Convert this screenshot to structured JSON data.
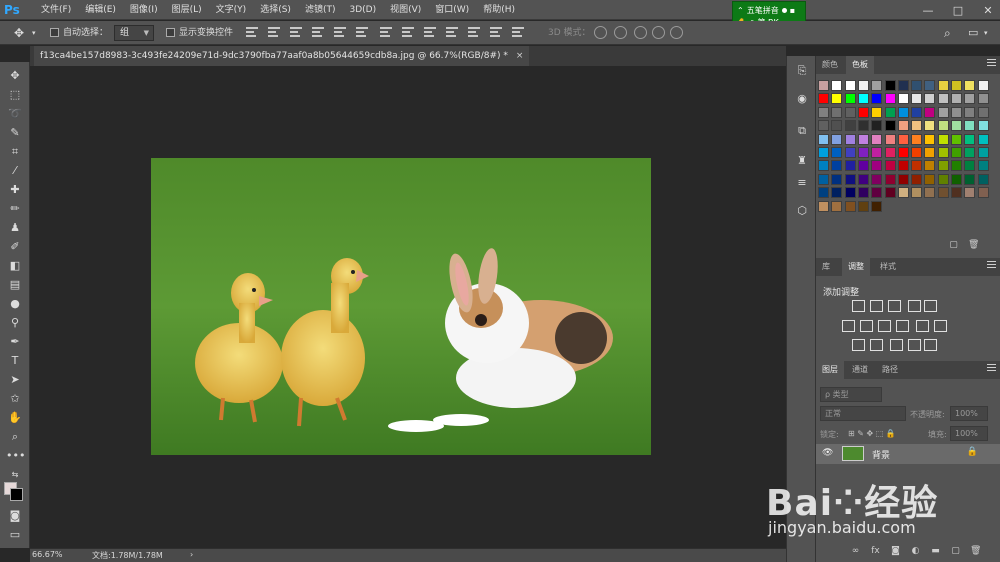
{
  "app": {
    "logo": "Ps"
  },
  "menu": [
    "文件(F)",
    "编辑(E)",
    "图像(I)",
    "图层(L)",
    "文字(Y)",
    "选择(S)",
    "滤镜(T)",
    "3D(D)",
    "视图(V)",
    "窗口(W)",
    "帮助(H)"
  ],
  "window_controls": [
    "—",
    "□",
    "✕"
  ],
  "ime": {
    "line1": "五笔拼音",
    "line2": "简 BK"
  },
  "options": {
    "auto_select_label": "自动选择：",
    "auto_select_value": "组",
    "show_transform_label": "显示变换控件",
    "mode_3d_label": "3D 模式："
  },
  "document": {
    "tab_title": "f13ca4be157d8983-3c493fe24209e71d-9dc3790fba77aaf0a8b05644659cdb8a.jpg @ 66.7%(RGB/8#) *",
    "tab_close": "×"
  },
  "status": {
    "zoom": "66.67%",
    "doc_info": "文档:1.78M/1.78M",
    "arrow": "›"
  },
  "swatches_panel": {
    "tabs": [
      "颜色",
      "色板"
    ],
    "active_tab": 1
  },
  "adjust_panel": {
    "tabs": [
      "库",
      "调整",
      "样式"
    ],
    "active_tab": 1,
    "title": "添加调整"
  },
  "layers_panel": {
    "tabs": [
      "图层",
      "通道",
      "路径"
    ],
    "active_tab": 0,
    "filter_label": "ρ 类型",
    "blend_mode": "正常",
    "opacity_label": "不透明度:",
    "opacity_value": "100%",
    "lock_label": "锁定:",
    "fill_label": "填充:",
    "fill_value": "100%",
    "layer_name": "背景",
    "footer": [
      "∞",
      "fx",
      "◙",
      "◐",
      "▬",
      "▢",
      "🗑"
    ]
  },
  "watermark": {
    "logo": "Bai⁘经验",
    "url": "jingyan.baidu.com"
  },
  "colors": {
    "menubar": "#535353",
    "canvas_bg": "#282828",
    "ime_green": "#0d7a16",
    "ps_blue": "#31a8ff"
  },
  "swatch_colors": [
    [
      "#c8a0a0",
      "#ffffff",
      "#ffffff",
      "#f0f0f0",
      "#a0a0a0",
      "#000000",
      "#203050",
      "#305070",
      "#406080",
      "#e8d040",
      "#d0c020",
      "#f0e060",
      "#f0f0f0"
    ],
    [
      "#ff0000",
      "#ffff00",
      "#00ff00",
      "#00ffff",
      "#0000ff",
      "#ff00ff",
      "#ffffff",
      "#e8e8e8",
      "#d0d0d0",
      "#c0c0c0",
      "#b0b0b0",
      "#a0a0a0",
      "#909090"
    ],
    [
      "#808080",
      "#707070",
      "#606060",
      "#ff0000",
      "#ffd000",
      "#00a050",
      "#0090e0",
      "#2040a0",
      "#c00080",
      "#a0a0a0",
      "#909090",
      "#808080",
      "#707070"
    ],
    [
      "#606060",
      "#505050",
      "#404040",
      "#303030",
      "#202020",
      "#000000",
      "#f0a080",
      "#f0c080",
      "#f0e080",
      "#c0e080",
      "#a0e0a0",
      "#80e0c0",
      "#80e0e0"
    ],
    [
      "#80c0f0",
      "#80a0e0",
      "#a080e0",
      "#c080e0",
      "#e080c0",
      "#f08080",
      "#ff6040",
      "#ff8020",
      "#ffc000",
      "#c0e000",
      "#60c000",
      "#00c080",
      "#00c0c0"
    ],
    [
      "#00a0e0",
      "#0060c0",
      "#4040c0",
      "#8020c0",
      "#c020a0",
      "#e02060",
      "#ff0000",
      "#f04000",
      "#f0a000",
      "#a0c000",
      "#40a000",
      "#00a060",
      "#00a0a0"
    ],
    [
      "#0080c0",
      "#0040a0",
      "#2020a0",
      "#6000a0",
      "#a00080",
      "#c00040",
      "#c00000",
      "#c03000",
      "#c08000",
      "#80a000",
      "#208000",
      "#008040",
      "#008080"
    ],
    [
      "#0060a0",
      "#003080",
      "#101080",
      "#400080",
      "#800060",
      "#900030",
      "#900000",
      "#902000",
      "#906000",
      "#608000",
      "#106000",
      "#006030",
      "#006060"
    ],
    [
      "#004080",
      "#002060",
      "#000060",
      "#300060",
      "#600040",
      "#600020",
      "#d0b080",
      "#b09060",
      "#907050",
      "#705030",
      "#503020",
      "#a08070",
      "#806050"
    ],
    [
      "#c09060",
      "#a07040",
      "#805020",
      "#604010",
      "#402000"
    ]
  ]
}
